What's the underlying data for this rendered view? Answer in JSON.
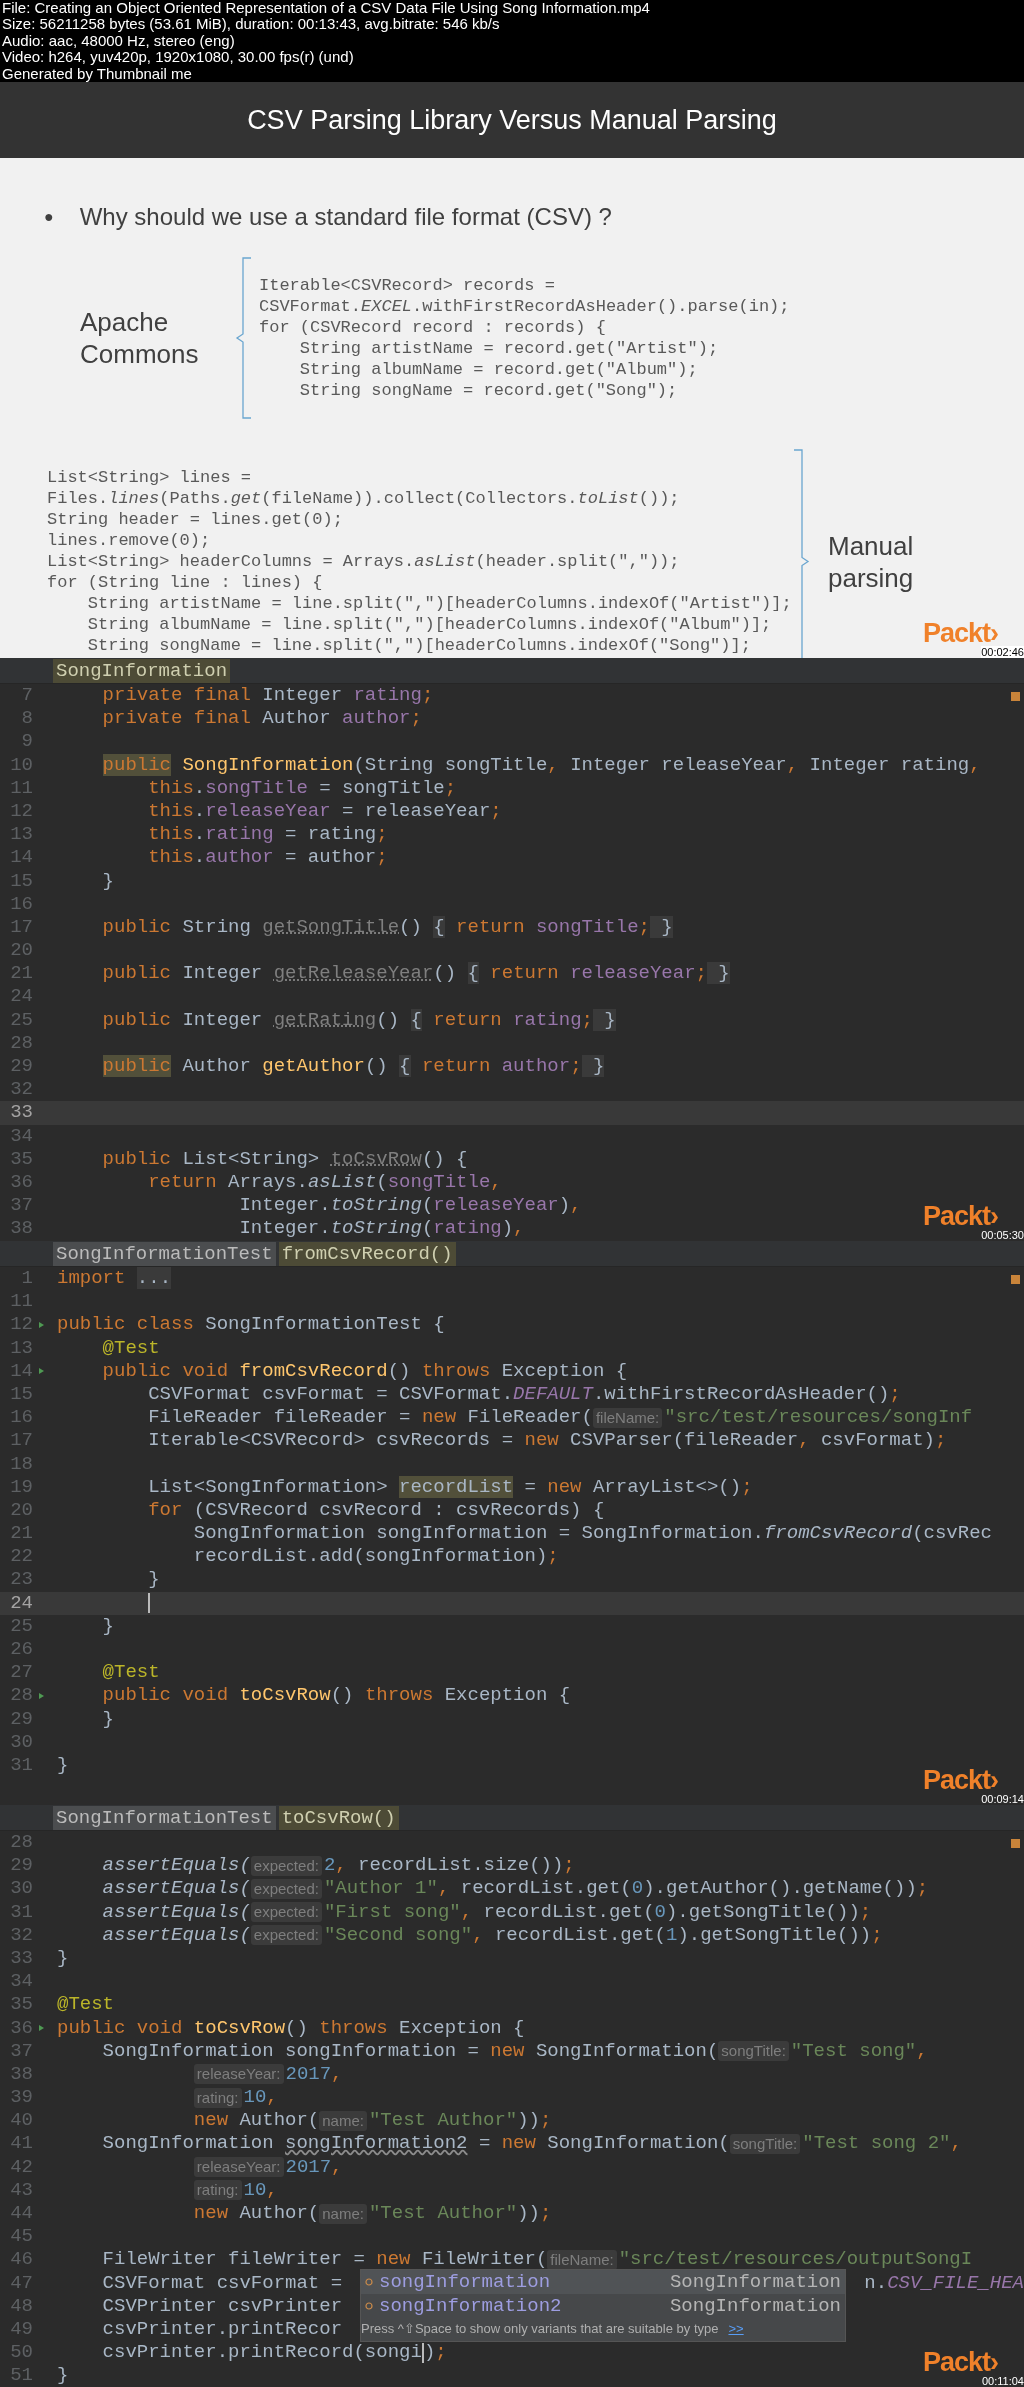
{
  "file_info": [
    "File: Creating an Object Oriented Representation of a CSV Data File Using Song Information.mp4",
    "Size: 56211258 bytes (53.61 MiB), duration: 00:13:43, avg.bitrate: 546 kb/s",
    "Audio: aac, 48000 Hz, stereo (eng)",
    "Video: h264, yuv420p, 1920x1080, 30.00 fps(r) (und)",
    "Generated by Thumbnail me"
  ],
  "slide": {
    "title": "CSV Parsing Library Versus Manual Parsing",
    "bullet_symbol": "●",
    "bullet": "Why should we use a standard file format (CSV) ?",
    "groups": [
      {
        "label": "Apache Commons",
        "kind": "left",
        "code": [
          "Iterable<CSVRecord> records =",
          "CSVFormat.*EXCEL*.withFirstRecordAsHeader().parse(in);",
          "for (CSVRecord record : records) {",
          "    String artistName = record.get(\"Artist\");",
          "    String albumName = record.get(\"Album\");",
          "    String songName = record.get(\"Song\");"
        ]
      },
      {
        "label": "Manual parsing",
        "kind": "right",
        "code": [
          "List<String> lines =",
          "Files.*lines*(Paths.*get*(fileName)).collect(Collectors.*toList*());",
          "String header = lines.get(0);",
          "lines.remove(0);",
          "List<String> headerColumns = Arrays.*asList*(header.split(\",\"));",
          "for (String line : lines) {",
          "    String artistName = line.split(\",\")[headerColumns.indexOf(\"Artist\")];",
          "    String albumName = line.split(\",\")[headerColumns.indexOf(\"Album\")];",
          "    String songName = line.split(\",\")[headerColumns.indexOf(\"Song\")];"
        ]
      }
    ],
    "logo": "Packt›",
    "timestamp": "00:02:46"
  },
  "editors": [
    {
      "breadcrumbs": [
        {
          "label": "SongInformation",
          "selected": true
        }
      ],
      "logo": "Packt›",
      "timestamp": "00:05:30",
      "lines": [
        {
          "n": "7",
          "current": false,
          "s": [
            {
              "kind": "keyword",
              "text": "    private final "
            },
            {
              "kind": "plain",
              "text": "Integer "
            },
            {
              "kind": "field",
              "text": "rating"
            },
            {
              "kind": "keyword",
              "text": ";"
            }
          ]
        },
        {
          "n": "8",
          "current": false,
          "s": [
            {
              "kind": "keyword",
              "text": "    private final "
            },
            {
              "kind": "plain",
              "text": "Author "
            },
            {
              "kind": "field",
              "text": "author"
            },
            {
              "kind": "keyword",
              "text": ";"
            }
          ]
        },
        {
          "n": "9",
          "current": false
        },
        {
          "n": "10",
          "current": false,
          "s": [
            {
              "kind": "markedkeyword",
              "text": "    public"
            },
            {
              "kind": "method",
              "text": " SongInformation"
            },
            {
              "kind": "plain",
              "text": "(String songTitle"
            },
            {
              "kind": "keyword",
              "text": ", "
            },
            {
              "kind": "plain",
              "text": "Integer releaseYear"
            },
            {
              "kind": "keyword",
              "text": ", "
            },
            {
              "kind": "plain",
              "text": "Integer rating"
            },
            {
              "kind": "keyword",
              "text": ","
            }
          ]
        },
        {
          "n": "11",
          "current": false,
          "s": [
            {
              "kind": "keyword",
              "text": "        this"
            },
            {
              "kind": "plain",
              "text": "."
            },
            {
              "kind": "field",
              "text": "songTitle"
            },
            {
              "kind": "plain",
              "text": " = songTitle"
            },
            {
              "kind": "keyword",
              "text": ";"
            }
          ]
        },
        {
          "n": "12",
          "current": false,
          "s": [
            {
              "kind": "keyword",
              "text": "        this"
            },
            {
              "kind": "plain",
              "text": "."
            },
            {
              "kind": "field",
              "text": "releaseYear"
            },
            {
              "kind": "plain",
              "text": " = releaseYear"
            },
            {
              "kind": "keyword",
              "text": ";"
            }
          ]
        },
        {
          "n": "13",
          "current": false,
          "s": [
            {
              "kind": "keyword",
              "text": "        this"
            },
            {
              "kind": "plain",
              "text": "."
            },
            {
              "kind": "field",
              "text": "rating"
            },
            {
              "kind": "plain",
              "text": " = rating"
            },
            {
              "kind": "keyword",
              "text": ";"
            }
          ]
        },
        {
          "n": "14",
          "current": false,
          "s": [
            {
              "kind": "keyword",
              "text": "        this"
            },
            {
              "kind": "plain",
              "text": "."
            },
            {
              "kind": "field",
              "text": "author"
            },
            {
              "kind": "plain",
              "text": " = author"
            },
            {
              "kind": "keyword",
              "text": ";"
            }
          ]
        },
        {
          "n": "15",
          "current": false,
          "s": [
            {
              "kind": "plain",
              "text": "    }"
            }
          ]
        },
        {
          "n": "16",
          "current": false
        },
        {
          "n": "17",
          "current": false,
          "s": [
            {
              "kind": "keyword",
              "text": "    public "
            },
            {
              "kind": "plain",
              "text": "String "
            },
            {
              "kind": "unused",
              "text": "getSongTitle"
            },
            {
              "kind": "plain",
              "text": "() "
            },
            {
              "kind": "fold",
              "text": "{"
            },
            {
              "kind": "keyword",
              "text": " return "
            },
            {
              "kind": "field",
              "text": "songTitle"
            },
            {
              "kind": "keyword",
              "text": ";"
            },
            {
              "kind": "fold",
              "text": " }"
            }
          ]
        },
        {
          "n": "20",
          "current": false
        },
        {
          "n": "21",
          "current": false,
          "s": [
            {
              "kind": "keyword",
              "text": "    public "
            },
            {
              "kind": "plain",
              "text": "Integer "
            },
            {
              "kind": "unused",
              "text": "getReleaseYear"
            },
            {
              "kind": "plain",
              "text": "() "
            },
            {
              "kind": "fold",
              "text": "{"
            },
            {
              "kind": "keyword",
              "text": " return "
            },
            {
              "kind": "field",
              "text": "releaseYear"
            },
            {
              "kind": "keyword",
              "text": ";"
            },
            {
              "kind": "fold",
              "text": " }"
            }
          ]
        },
        {
          "n": "24",
          "current": false
        },
        {
          "n": "25",
          "current": false,
          "s": [
            {
              "kind": "keyword",
              "text": "    public "
            },
            {
              "kind": "plain",
              "text": "Integer "
            },
            {
              "kind": "unused",
              "text": "getRating"
            },
            {
              "kind": "plain",
              "text": "() "
            },
            {
              "kind": "fold",
              "text": "{"
            },
            {
              "kind": "keyword",
              "text": " return "
            },
            {
              "kind": "field",
              "text": "rating"
            },
            {
              "kind": "keyword",
              "text": ";"
            },
            {
              "kind": "fold",
              "text": " }"
            }
          ]
        },
        {
          "n": "28",
          "current": false
        },
        {
          "n": "29",
          "current": false,
          "s": [
            {
              "kind": "markedkeyword",
              "text": "    public"
            },
            {
              "kind": "plain",
              "text": " Author "
            },
            {
              "kind": "method",
              "text": "getAuthor"
            },
            {
              "kind": "plain",
              "text": "() "
            },
            {
              "kind": "fold",
              "text": "{"
            },
            {
              "kind": "keyword",
              "text": " return "
            },
            {
              "kind": "field",
              "text": "author"
            },
            {
              "kind": "keyword",
              "text": ";"
            },
            {
              "kind": "fold",
              "text": " }"
            }
          ]
        },
        {
          "n": "32",
          "current": false
        },
        {
          "n": "33",
          "current": true
        },
        {
          "n": "34",
          "current": false
        },
        {
          "n": "35",
          "current": false,
          "s": [
            {
              "kind": "keyword",
              "text": "    public "
            },
            {
              "kind": "plain",
              "text": "List<String> "
            },
            {
              "kind": "unused",
              "text": "toCsvRow"
            },
            {
              "kind": "plain",
              "text": "() {"
            }
          ]
        },
        {
          "n": "36",
          "current": false,
          "s": [
            {
              "kind": "keyword",
              "text": "        return "
            },
            {
              "kind": "plain",
              "text": "Arrays."
            },
            {
              "kind": "static",
              "text": "asList"
            },
            {
              "kind": "plain",
              "text": "("
            },
            {
              "kind": "field",
              "text": "songTitle"
            },
            {
              "kind": "keyword",
              "text": ","
            }
          ]
        },
        {
          "n": "37",
          "current": false,
          "s": [
            {
              "kind": "plain",
              "text": "                Integer."
            },
            {
              "kind": "static",
              "text": "toString"
            },
            {
              "kind": "plain",
              "text": "("
            },
            {
              "kind": "field",
              "text": "releaseYear"
            },
            {
              "kind": "plain",
              "text": ")"
            },
            {
              "kind": "keyword",
              "text": ","
            }
          ]
        },
        {
          "n": "38",
          "current": false,
          "s": [
            {
              "kind": "plain",
              "text": "                Integer."
            },
            {
              "kind": "static",
              "text": "toString"
            },
            {
              "kind": "plain",
              "text": "("
            },
            {
              "kind": "field",
              "text": "rating"
            },
            {
              "kind": "plain",
              "text": ")"
            },
            {
              "kind": "keyword",
              "text": ","
            }
          ]
        }
      ]
    },
    {
      "breadcrumbs": [
        {
          "label": "SongInformationTest",
          "selected": false
        },
        {
          "label": "fromCsvRecord()",
          "selected": true
        }
      ],
      "logo": "Packt›",
      "timestamp": "00:09:14",
      "lines": [
        {
          "n": "1",
          "current": false,
          "s": [
            {
              "kind": "keyword",
              "text": "import "
            },
            {
              "kind": "fold",
              "text": "..."
            }
          ]
        },
        {
          "n": "11",
          "current": false
        },
        {
          "n": "12",
          "current": false,
          "run": true,
          "s": [
            {
              "kind": "keyword",
              "text": "public class "
            },
            {
              "kind": "plain",
              "text": "SongInformationTest {"
            }
          ]
        },
        {
          "n": "13",
          "current": false,
          "s": [
            {
              "kind": "annotation",
              "text": "    @Test"
            }
          ]
        },
        {
          "n": "14",
          "current": false,
          "run": true,
          "s": [
            {
              "kind": "keyword",
              "text": "    public void "
            },
            {
              "kind": "method",
              "text": "fromCsvRecord"
            },
            {
              "kind": "plain",
              "text": "() "
            },
            {
              "kind": "keyword",
              "text": "throws "
            },
            {
              "kind": "plain",
              "text": "Exception {"
            }
          ]
        },
        {
          "n": "15",
          "current": false,
          "s": [
            {
              "kind": "plain",
              "text": "        CSVFormat csvFormat = CSVFormat."
            },
            {
              "kind": "constant",
              "text": "DEFAULT"
            },
            {
              "kind": "plain",
              "text": ".withFirstRecordAsHeader()"
            },
            {
              "kind": "keyword",
              "text": ";"
            }
          ]
        },
        {
          "n": "16",
          "current": false,
          "s": [
            {
              "kind": "plain",
              "text": "        FileReader fileReader = "
            },
            {
              "kind": "keyword",
              "text": "new "
            },
            {
              "kind": "plain",
              "text": "FileReader("
            },
            {
              "kind": "hint",
              "text": "fileName:"
            },
            {
              "kind": "string",
              "text": "\"src/test/resources/songInf"
            }
          ]
        },
        {
          "n": "17",
          "current": false,
          "s": [
            {
              "kind": "plain",
              "text": "        Iterable<CSVRecord> csvRecords = "
            },
            {
              "kind": "keyword",
              "text": "new "
            },
            {
              "kind": "plain",
              "text": "CSVParser(fileReader"
            },
            {
              "kind": "keyword",
              "text": ", "
            },
            {
              "kind": "plain",
              "text": "csvFormat)"
            },
            {
              "kind": "keyword",
              "text": ";"
            }
          ]
        },
        {
          "n": "18",
          "current": false
        },
        {
          "n": "19",
          "current": false,
          "s": [
            {
              "kind": "plain",
              "text": "        List<SongInformation> "
            },
            {
              "kind": "markedplain",
              "text": "recordList"
            },
            {
              "kind": "plain",
              "text": " = "
            },
            {
              "kind": "keyword",
              "text": "new "
            },
            {
              "kind": "plain",
              "text": "ArrayList<>()"
            },
            {
              "kind": "keyword",
              "text": ";"
            }
          ]
        },
        {
          "n": "20",
          "current": false,
          "s": [
            {
              "kind": "keyword",
              "text": "        for "
            },
            {
              "kind": "plain",
              "text": "(CSVRecord csvRecord : csvRecords) {"
            }
          ]
        },
        {
          "n": "21",
          "current": false,
          "s": [
            {
              "kind": "plain",
              "text": "            SongInformation songInformation = SongInformation."
            },
            {
              "kind": "static",
              "text": "fromCsvRecord"
            },
            {
              "kind": "plain",
              "text": "(csvRec"
            }
          ]
        },
        {
          "n": "22",
          "current": false,
          "s": [
            {
              "kind": "plain",
              "text": "            recordList.add(songInformation)"
            },
            {
              "kind": "keyword",
              "text": ";"
            }
          ]
        },
        {
          "n": "23",
          "current": false,
          "s": [
            {
              "kind": "plain",
              "text": "        }"
            }
          ]
        },
        {
          "n": "24",
          "current": true,
          "s": [
            {
              "kind": "caret"
            }
          ]
        },
        {
          "n": "25",
          "current": false,
          "s": [
            {
              "kind": "plain",
              "text": "    }"
            }
          ]
        },
        {
          "n": "26",
          "current": false
        },
        {
          "n": "27",
          "current": false,
          "s": [
            {
              "kind": "annotation",
              "text": "    @Test"
            }
          ]
        },
        {
          "n": "28",
          "current": false,
          "run": true,
          "s": [
            {
              "kind": "keyword",
              "text": "    public void "
            },
            {
              "kind": "method",
              "text": "toCsvRow"
            },
            {
              "kind": "plain",
              "text": "() "
            },
            {
              "kind": "keyword",
              "text": "throws "
            },
            {
              "kind": "plain",
              "text": "Exception {"
            }
          ]
        },
        {
          "n": "29",
          "current": false,
          "s": [
            {
              "kind": "plain",
              "text": "    }"
            }
          ]
        },
        {
          "n": "30",
          "current": false
        },
        {
          "n": "31",
          "current": false,
          "s": [
            {
              "kind": "plain",
              "text": "}"
            }
          ]
        }
      ]
    },
    {
      "breadcrumbs": [
        {
          "label": "SongInformationTest",
          "selected": false
        },
        {
          "label": "toCsvRow()",
          "selected": true
        }
      ],
      "logo": "Packt›",
      "timestamp": "00:11:04",
      "lines": [
        {
          "n": "28",
          "current": false
        },
        {
          "n": "29",
          "current": false,
          "s": [
            {
              "kind": "static",
              "text": "    assertEquals("
            },
            {
              "kind": "hint",
              "text": "expected:"
            },
            {
              "kind": "number",
              "text": "2"
            },
            {
              "kind": "keyword",
              "text": ", "
            },
            {
              "kind": "plain",
              "text": "recordList.size())"
            },
            {
              "kind": "keyword",
              "text": ";"
            }
          ]
        },
        {
          "n": "30",
          "current": false,
          "s": [
            {
              "kind": "static",
              "text": "    assertEquals("
            },
            {
              "kind": "hint",
              "text": "expected:"
            },
            {
              "kind": "string",
              "text": "\"Author 1\""
            },
            {
              "kind": "keyword",
              "text": ", "
            },
            {
              "kind": "plain",
              "text": "recordList.get("
            },
            {
              "kind": "number",
              "text": "0"
            },
            {
              "kind": "plain",
              "text": ").getAuthor().getName())"
            },
            {
              "kind": "keyword",
              "text": ";"
            }
          ]
        },
        {
          "n": "31",
          "current": false,
          "s": [
            {
              "kind": "static",
              "text": "    assertEquals("
            },
            {
              "kind": "hint",
              "text": "expected:"
            },
            {
              "kind": "string",
              "text": "\"First song\""
            },
            {
              "kind": "keyword",
              "text": ", "
            },
            {
              "kind": "plain",
              "text": "recordList.get("
            },
            {
              "kind": "number",
              "text": "0"
            },
            {
              "kind": "plain",
              "text": ").getSongTitle())"
            },
            {
              "kind": "keyword",
              "text": ";"
            }
          ]
        },
        {
          "n": "32",
          "current": false,
          "s": [
            {
              "kind": "static",
              "text": "    assertEquals("
            },
            {
              "kind": "hint",
              "text": "expected:"
            },
            {
              "kind": "string",
              "text": "\"Second song\""
            },
            {
              "kind": "keyword",
              "text": ", "
            },
            {
              "kind": "plain",
              "text": "recordList.get("
            },
            {
              "kind": "number",
              "text": "1"
            },
            {
              "kind": "plain",
              "text": ").getSongTitle())"
            },
            {
              "kind": "keyword",
              "text": ";"
            }
          ]
        },
        {
          "n": "33",
          "current": false,
          "s": [
            {
              "kind": "plain",
              "text": "}"
            }
          ]
        },
        {
          "n": "34",
          "current": false
        },
        {
          "n": "35",
          "current": false,
          "s": [
            {
              "kind": "annotation",
              "text": "@Test"
            }
          ]
        },
        {
          "n": "36",
          "current": false,
          "run": true,
          "s": [
            {
              "kind": "keyword",
              "text": "public void "
            },
            {
              "kind": "method",
              "text": "toCsvRow"
            },
            {
              "kind": "plain",
              "text": "() "
            },
            {
              "kind": "keyword",
              "text": "throws "
            },
            {
              "kind": "plain",
              "text": "Exception {"
            }
          ]
        },
        {
          "n": "37",
          "current": false,
          "s": [
            {
              "kind": "plain",
              "text": "    SongInformation songInformation = "
            },
            {
              "kind": "keyword",
              "text": "new "
            },
            {
              "kind": "plain",
              "text": "SongInformation("
            },
            {
              "kind": "hint",
              "text": "songTitle:"
            },
            {
              "kind": "string",
              "text": "\"Test song\""
            },
            {
              "kind": "keyword",
              "text": ","
            }
          ]
        },
        {
          "n": "38",
          "current": false,
          "s": [
            {
              "kind": "hint",
              "text": "            releaseYear:"
            },
            {
              "kind": "number",
              "text": "2017"
            },
            {
              "kind": "keyword",
              "text": ","
            }
          ]
        },
        {
          "n": "39",
          "current": false,
          "s": [
            {
              "kind": "hint",
              "text": "            rating:"
            },
            {
              "kind": "number",
              "text": "10"
            },
            {
              "kind": "keyword",
              "text": ","
            }
          ]
        },
        {
          "n": "40",
          "current": false,
          "s": [
            {
              "kind": "keyword",
              "text": "            new "
            },
            {
              "kind": "plain",
              "text": "Author("
            },
            {
              "kind": "hint",
              "text": "name:"
            },
            {
              "kind": "string",
              "text": "\"Test Author\""
            },
            {
              "kind": "plain",
              "text": "))"
            },
            {
              "kind": "keyword",
              "text": ";"
            }
          ]
        },
        {
          "n": "41",
          "current": false,
          "s": [
            {
              "kind": "plain",
              "text": "    SongInformation "
            },
            {
              "kind": "warning",
              "text": "songInformation2"
            },
            {
              "kind": "plain",
              "text": " = "
            },
            {
              "kind": "keyword",
              "text": "new "
            },
            {
              "kind": "plain",
              "text": "SongInformation("
            },
            {
              "kind": "hint",
              "text": "songTitle:"
            },
            {
              "kind": "string",
              "text": "\"Test song 2\""
            },
            {
              "kind": "keyword",
              "text": ","
            }
          ]
        },
        {
          "n": "42",
          "current": false,
          "s": [
            {
              "kind": "hint",
              "text": "            releaseYear:"
            },
            {
              "kind": "number",
              "text": "2017"
            },
            {
              "kind": "keyword",
              "text": ","
            }
          ]
        },
        {
          "n": "43",
          "current": false,
          "s": [
            {
              "kind": "hint",
              "text": "            rating:"
            },
            {
              "kind": "number",
              "text": "10"
            },
            {
              "kind": "keyword",
              "text": ","
            }
          ]
        },
        {
          "n": "44",
          "current": false,
          "s": [
            {
              "kind": "keyword",
              "text": "            new "
            },
            {
              "kind": "plain",
              "text": "Author("
            },
            {
              "kind": "hint",
              "text": "name:"
            },
            {
              "kind": "string",
              "text": "\"Test Author\""
            },
            {
              "kind": "plain",
              "text": "))"
            },
            {
              "kind": "keyword",
              "text": ";"
            }
          ]
        },
        {
          "n": "45",
          "current": false
        },
        {
          "n": "46",
          "current": false,
          "s": [
            {
              "kind": "plain",
              "text": "    FileWriter fileWriter = "
            },
            {
              "kind": "keyword",
              "text": "new "
            },
            {
              "kind": "plain",
              "text": "FileWriter("
            },
            {
              "kind": "hint",
              "text": "fileName:"
            },
            {
              "kind": "string",
              "text": "\"src/test/resources/outputSongI"
            }
          ]
        },
        {
          "n": "47",
          "current": false,
          "s": [
            {
              "kind": "plain",
              "text": "    CSVFormat csvFormat ="
            }
          ],
          "right": [
            {
              "kind": "plain",
              "text": "n."
            },
            {
              "kind": "constant",
              "text": "CSV_FILE_HEA"
            }
          ]
        },
        {
          "n": "48",
          "current": false,
          "s": [
            {
              "kind": "plain",
              "text": "    CSVPrinter csvPrinter"
            }
          ]
        },
        {
          "n": "49",
          "current": false,
          "s": [
            {
              "kind": "plain",
              "text": "    csvPrinter.printRecor"
            }
          ]
        },
        {
          "n": "50",
          "current": false,
          "s": [
            {
              "kind": "plain",
              "text": "    csvPrinter.printRecord(songi"
            },
            {
              "kind": "caret"
            },
            {
              "kind": "plain",
              "text": ")"
            },
            {
              "kind": "keyword",
              "text": ";"
            }
          ]
        },
        {
          "n": "51",
          "current": false,
          "s": [
            {
              "kind": "plain",
              "text": "}"
            }
          ]
        }
      ],
      "completion": {
        "items": [
          {
            "name": "songInformation",
            "type": "SongInformation",
            "selected": true
          },
          {
            "name": "songInformation2",
            "type": "SongInformation",
            "selected": false
          }
        ],
        "hint": "Press ^⇧Space to show only variants that are suitable by type",
        "link": ">>"
      }
    }
  ]
}
